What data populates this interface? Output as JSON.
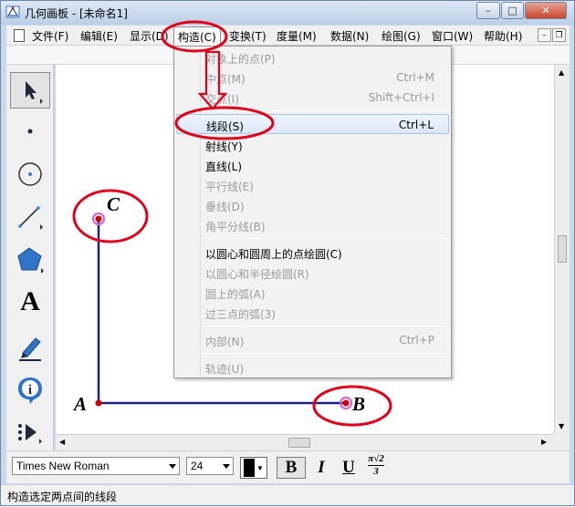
{
  "window": {
    "title": "几何画板 - [未命名1]",
    "caption_minimize": "–",
    "caption_maximize": "□",
    "caption_close": "✕"
  },
  "menubar": {
    "items": [
      {
        "label": "文件(F)"
      },
      {
        "label": "编辑(E)"
      },
      {
        "label": "显示(D)"
      },
      {
        "label": "构造(C)"
      },
      {
        "label": "变换(T)"
      },
      {
        "label": "度量(M)"
      },
      {
        "label": "数据(N)"
      },
      {
        "label": "绘图(G)"
      },
      {
        "label": "窗口(W)"
      },
      {
        "label": "帮助(H)"
      }
    ],
    "active_index": 3,
    "mdi_minimize": "–",
    "mdi_restore": "❐",
    "mdi_close": "✕"
  },
  "construct_menu": {
    "items": [
      {
        "label": "对象上的点(P)",
        "shortcut": "",
        "enabled": false
      },
      {
        "label": "中点(M)",
        "shortcut": "Ctrl+M",
        "enabled": false
      },
      {
        "label": "交点(I)",
        "shortcut": "Shift+Ctrl+I",
        "enabled": false
      },
      {
        "label": "线段(S)",
        "shortcut": "Ctrl+L",
        "enabled": true,
        "highlighted": true
      },
      {
        "label": "射线(Y)",
        "shortcut": "",
        "enabled": true
      },
      {
        "label": "直线(L)",
        "shortcut": "",
        "enabled": true
      },
      {
        "label": "平行线(E)",
        "shortcut": "",
        "enabled": false
      },
      {
        "label": "垂线(D)",
        "shortcut": "",
        "enabled": false
      },
      {
        "label": "角平分线(B)",
        "shortcut": "",
        "enabled": false
      },
      {
        "label": "以圆心和圆周上的点绘圆(C)",
        "shortcut": "",
        "enabled": true
      },
      {
        "label": "以圆心和半径绘圆(R)",
        "shortcut": "",
        "enabled": false
      },
      {
        "label": "圆上的弧(A)",
        "shortcut": "",
        "enabled": false
      },
      {
        "label": "过三点的弧(3)",
        "shortcut": "",
        "enabled": false
      },
      {
        "label": "内部(N)",
        "shortcut": "Ctrl+P",
        "enabled": false
      },
      {
        "label": "轨迹(U)",
        "shortcut": "",
        "enabled": false
      }
    ]
  },
  "toolbox": {
    "tools": [
      {
        "name": "selection-arrow-tool-icon"
      },
      {
        "name": "point-tool-icon"
      },
      {
        "name": "compass-tool-icon"
      },
      {
        "name": "straightedge-tool-icon"
      },
      {
        "name": "polygon-tool-icon"
      },
      {
        "name": "text-tool-icon",
        "glyph": "A"
      },
      {
        "name": "marker-tool-icon"
      },
      {
        "name": "information-tool-icon",
        "glyph": "i"
      },
      {
        "name": "custom-tool-icon"
      }
    ]
  },
  "canvas": {
    "points": [
      {
        "label": "A"
      },
      {
        "label": "B"
      },
      {
        "label": "C"
      }
    ],
    "colors": {
      "segment": "#1a237e",
      "point_fill": "#cc0000",
      "point_ring": "#d65cd6",
      "annotation": "#e0001b"
    }
  },
  "formatbar": {
    "font_name": "Times New Roman",
    "font_size": "24",
    "bold_label": "B",
    "italic_label": "I",
    "underline_label": "U",
    "math_label_top": "π√2",
    "math_label_bottom": "3"
  },
  "statusbar": {
    "text": "构造选定两点间的线段"
  }
}
